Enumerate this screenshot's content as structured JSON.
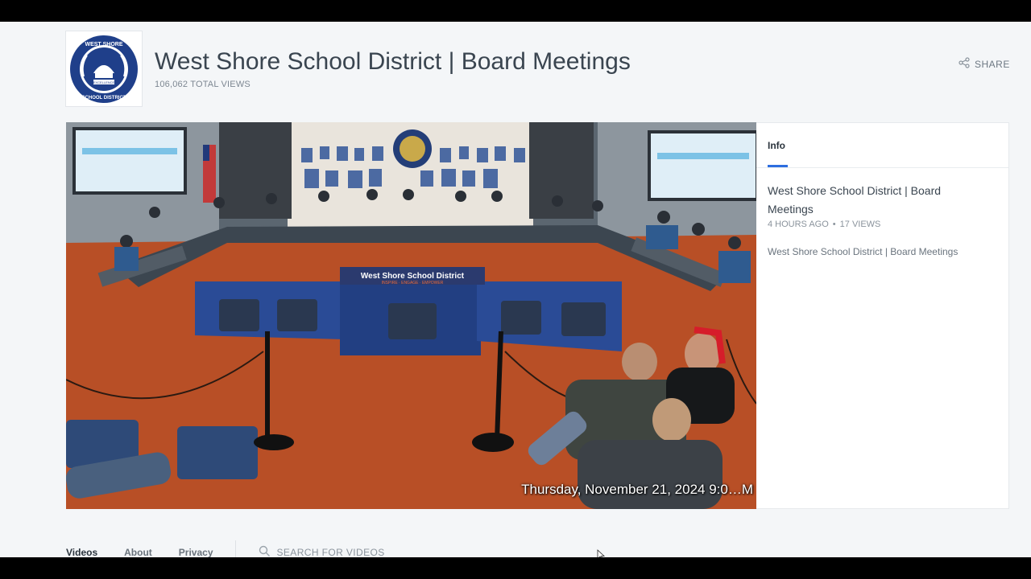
{
  "channel": {
    "title": "West Shore School District | Board Meetings",
    "total_views": "106,062 TOTAL VIEWS",
    "share_label": "SHARE",
    "logo_text_top": "WEST SHORE",
    "logo_text_bottom": "SCHOOL DISTRICT",
    "logo_banner": "EXCELLENCE"
  },
  "player": {
    "timestamp_overlay": "Thursday, November 21, 2024 9:0…M",
    "table_banner": "West Shore School District",
    "table_banner_sub": "INSPIRE · ENGAGE · EMPOWER"
  },
  "info": {
    "tab_label": "Info",
    "video_title": "West Shore School District | Board Meetings",
    "posted": "4 HOURS AGO",
    "separator": "•",
    "views": "17 VIEWS",
    "description": "West Shore School District | Board Meetings"
  },
  "nav": {
    "videos": "Videos",
    "about": "About",
    "privacy": "Privacy",
    "search_placeholder": "SEARCH FOR VIDEOS"
  },
  "colors": {
    "accent": "#2d6ee0",
    "page_bg": "#f4f6f8",
    "floor": "#b84f26",
    "logo_navy": "#1f3f8a"
  }
}
